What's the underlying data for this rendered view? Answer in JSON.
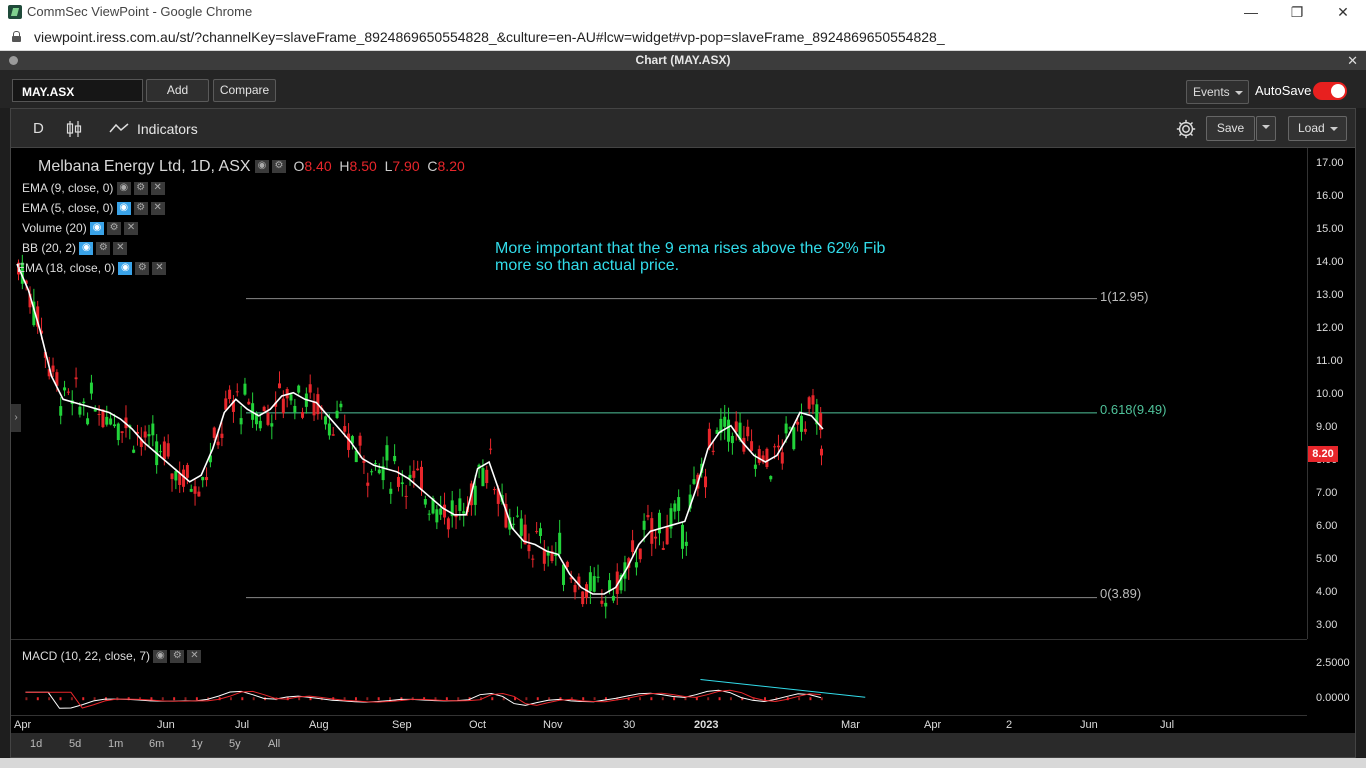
{
  "browser": {
    "tab_title": "CommSec ViewPoint - Google Chrome",
    "url": "viewpoint.iress.com.au/st/?channelKey=slaveFrame_8924869650554828_&culture=en-AU#lcw=widget#vp-pop=slaveFrame_8924869650554828_"
  },
  "window": {
    "title": "Chart (MAY.ASX)"
  },
  "toolbar": {
    "symbol": "MAY.ASX",
    "add_label": "Add",
    "compare_label": "Compare",
    "events_label": "Events",
    "autosave_label": "AutoSave",
    "autosave_on": true
  },
  "chart_toolbar": {
    "interval": "D",
    "indicators_label": "Indicators",
    "save_label": "Save",
    "load_label": "Load"
  },
  "legend": {
    "title": "Melbana Energy Ltd, 1D, ASX",
    "o_label": "O",
    "o_value": "8.40",
    "h_label": "H",
    "h_value": "8.50",
    "l_label": "L",
    "l_value": "7.90",
    "c_label": "C",
    "c_value": "8.20",
    "indicators": [
      "EMA (9, close, 0)",
      "EMA (5, close, 0)",
      "Volume (20)",
      "BB (20, 2)",
      "EMA (18, close, 0)"
    ],
    "macd_label": "MACD (10, 22, close, 7)"
  },
  "annotation": {
    "line1": "More important that the 9 ema rises above the 62% Fib",
    "line2": "more so than actual price."
  },
  "fib_labels": {
    "top": "1(12.95)",
    "mid": "0.618(9.49)",
    "bottom": "0(3.89)"
  },
  "colors": {
    "up": "#22d33a",
    "down": "#e8262b",
    "ema": "#ffffff",
    "fib_mid": "#4fc29a",
    "annotation": "#32dcea"
  },
  "y_ticks": [
    "17.00",
    "16.00",
    "15.00",
    "14.00",
    "13.00",
    "12.00",
    "11.00",
    "10.00",
    "9.00",
    "8.00",
    "7.00",
    "6.00",
    "5.00",
    "4.00",
    "3.00"
  ],
  "last_price": "8.20",
  "macd_ticks": [
    "2.5000",
    "0.0000"
  ],
  "x_ticks": [
    "Apr",
    "Jun",
    "Jul",
    "Aug",
    "Sep",
    "Oct",
    "Nov",
    "30",
    "2023",
    "Mar",
    "Apr",
    "2",
    "Jun",
    "Jul"
  ],
  "ranges": [
    "1d",
    "5d",
    "1m",
    "6m",
    "1y",
    "5y",
    "All"
  ],
  "chart_data": {
    "type": "candlestick",
    "title": "Melbana Energy Ltd, 1D, ASX",
    "ylim": [
      2.5,
      17.3
    ],
    "ema9": [
      14.0,
      13.2,
      12.0,
      10.6,
      9.9,
      9.8,
      9.7,
      9.6,
      9.5,
      9.3,
      9.0,
      8.6,
      8.3,
      8.0,
      7.7,
      7.4,
      7.6,
      8.4,
      9.5,
      9.9,
      9.6,
      9.4,
      9.6,
      10.0,
      10.1,
      9.9,
      9.8,
      9.4,
      9.0,
      8.6,
      8.1,
      7.9,
      7.8,
      7.7,
      7.5,
      7.2,
      6.9,
      6.6,
      6.4,
      6.4,
      7.8,
      8.0,
      7.0,
      6.0,
      5.6,
      5.5,
      5.3,
      5.2,
      4.6,
      4.2,
      4.0,
      4.0,
      4.2,
      4.8,
      5.5,
      5.9,
      6.0,
      6.1,
      6.2,
      7.2,
      8.4,
      8.9,
      9.1,
      8.6,
      8.2,
      8.0,
      8.2,
      8.8,
      9.5,
      9.4,
      9.0
    ],
    "fib": {
      "1": 12.95,
      "0.618": 9.49,
      "0": 3.89
    },
    "ohlc": {
      "open": 8.4,
      "high": 8.5,
      "low": 7.9,
      "close": 8.2
    }
  }
}
